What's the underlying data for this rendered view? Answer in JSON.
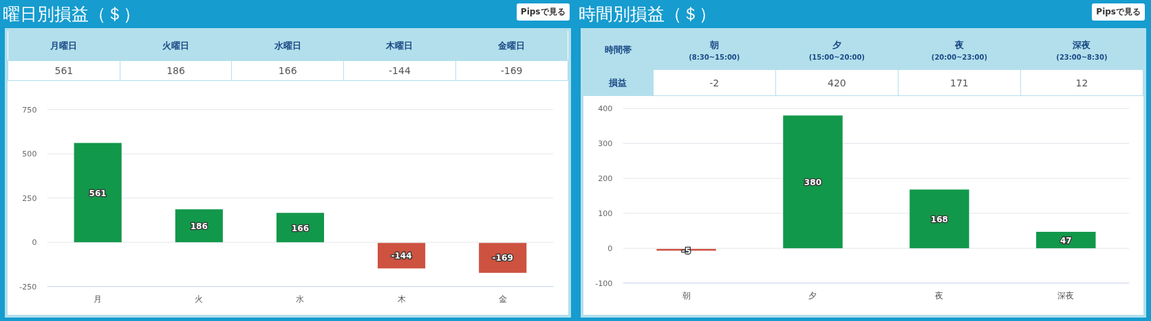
{
  "panels": [
    {
      "title": "曜日別損益（＄）",
      "button": "Pipsで見る",
      "table": {
        "columns": [
          {
            "label": "月曜日"
          },
          {
            "label": "火曜日"
          },
          {
            "label": "水曜日"
          },
          {
            "label": "木曜日"
          },
          {
            "label": "金曜日"
          }
        ],
        "values": [
          "561",
          "186",
          "166",
          "-144",
          "-169"
        ]
      },
      "chart_data": {
        "type": "bar",
        "categories": [
          "月",
          "火",
          "水",
          "木",
          "金"
        ],
        "series": [
          {
            "color": "#12984a",
            "values": [
              561,
              186,
              166,
              null,
              null
            ]
          },
          {
            "color": "#cd5240",
            "values": [
              null,
              null,
              null,
              -144,
              -169
            ]
          }
        ],
        "stacked": true,
        "grid": true,
        "ylim": [
          -250,
          750
        ],
        "yticks": [
          -250,
          0,
          250,
          500,
          750
        ],
        "value_labels": [
          "561",
          "186",
          "166",
          "-144",
          "-169"
        ]
      }
    },
    {
      "title": "時間別損益（＄）",
      "button": "Pipsで見る",
      "table": {
        "corner": "時間帯",
        "columns": [
          {
            "label": "朝",
            "sublabel": "(8:30~15:00)"
          },
          {
            "label": "夕",
            "sublabel": "(15:00~20:00)"
          },
          {
            "label": "夜",
            "sublabel": "(20:00~23:00)"
          },
          {
            "label": "深夜",
            "sublabel": "(23:00~8:30)"
          }
        ],
        "row_label": "損益",
        "values": [
          "-2",
          "420",
          "171",
          "12"
        ]
      },
      "chart_data": {
        "type": "bar",
        "categories": [
          "朝",
          "夕",
          "夜",
          "深夜"
        ],
        "series": [
          {
            "color": "#12984a",
            "values": [
              null,
              380,
              168,
              47
            ]
          },
          {
            "color": "#cd5240",
            "values": [
              -5,
              null,
              null,
              null
            ]
          }
        ],
        "stacked": true,
        "grid": true,
        "ylim": [
          -100,
          400
        ],
        "yticks": [
          -100,
          0,
          100,
          200,
          300,
          400
        ],
        "value_labels": [
          "-5",
          "380",
          "168",
          "47"
        ]
      }
    }
  ]
}
